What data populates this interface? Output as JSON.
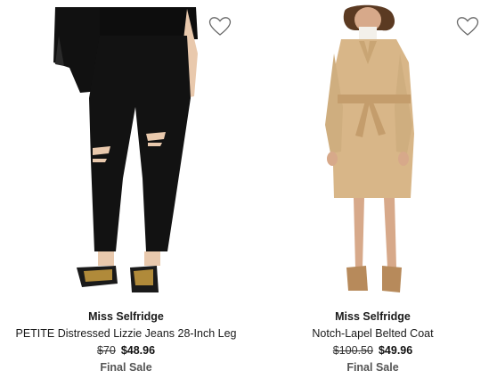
{
  "products": [
    {
      "brand": "Miss Selfridge",
      "title": "PETITE Distressed Lizzie Jeans 28-Inch Leg",
      "was_price": "$70",
      "price": "$48.96",
      "note": "Final Sale",
      "image_icon": "product-photo-jeans",
      "wishlist_icon": "heart-outline-icon"
    },
    {
      "brand": "Miss Selfridge",
      "title": "Notch-Lapel Belted Coat",
      "was_price": "$100.50",
      "price": "$49.96",
      "note": "Final Sale",
      "image_icon": "product-photo-coat",
      "wishlist_icon": "heart-outline-icon"
    }
  ]
}
